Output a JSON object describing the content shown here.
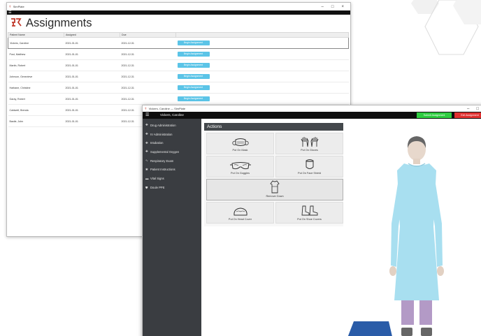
{
  "back_window": {
    "title": "SimPlate",
    "window_controls": [
      "–",
      "□",
      "×"
    ],
    "heading": "Assignments",
    "columns": [
      "Patient Name",
      "Assigned",
      "Due",
      ""
    ],
    "rows": [
      {
        "name": "Vickers, Caroline",
        "assigned": "2021-01-01",
        "due": "2021-12-31",
        "action": "Begin Assignment"
      },
      {
        "name": "Post, Matthew",
        "assigned": "2021-01-01",
        "due": "2021-12-31",
        "action": "Begin Assignment"
      },
      {
        "name": "Martin, Robert",
        "assigned": "2021-01-01",
        "due": "2021-12-31",
        "action": "Begin Assignment"
      },
      {
        "name": "Johnson, Genevieve",
        "assigned": "2021-01-01",
        "due": "2021-12-31",
        "action": "Begin Assignment"
      },
      {
        "name": "Harbane, Christine",
        "assigned": "2021-01-01",
        "due": "2021-12-31",
        "action": "Begin Assignment"
      },
      {
        "name": "Garay, Robert",
        "assigned": "2021-01-01",
        "due": "2021-12-31",
        "action": "Begin Assignment"
      },
      {
        "name": "Caldwell, Brenda",
        "assigned": "2021-01-01",
        "due": "2021-12-31",
        "action": ""
      },
      {
        "name": "Bastle, John",
        "assigned": "2021-01-01",
        "due": "2021-12-31",
        "action": ""
      }
    ]
  },
  "front_window": {
    "title": "Vickers, Caroline — SimPlate",
    "window_controls": [
      "–",
      "□"
    ],
    "patient_name": "Vickers, Caroline",
    "submit_label": "Submit Assignment",
    "exit_label": "Exit Assignment",
    "sidebar": [
      {
        "icon": "pill-icon",
        "glyph": "✚",
        "label": "Drug Administration"
      },
      {
        "icon": "iv-icon",
        "glyph": "✚",
        "label": "IV Administration"
      },
      {
        "icon": "intubate-icon",
        "glyph": "✚",
        "label": "Intubation"
      },
      {
        "icon": "oxygen-icon",
        "glyph": "✚",
        "label": "Supplemental Oxygen"
      },
      {
        "icon": "lungs-icon",
        "glyph": "∿",
        "label": "Respiratory Exam"
      },
      {
        "icon": "instructions-icon",
        "glyph": "✱",
        "label": "Patient Instructions"
      },
      {
        "icon": "monitor-icon",
        "glyph": "▬",
        "label": "Vital Signs"
      },
      {
        "icon": "shield-icon",
        "glyph": "⛊",
        "label": "Doule PPE"
      }
    ],
    "actions_heading": "Actions",
    "actions": [
      {
        "label": "Put On Mask",
        "icon": "mask-icon"
      },
      {
        "label": "Put On Gloves",
        "icon": "gloves-icon"
      },
      {
        "label": "Put On Goggles",
        "icon": "goggles-icon"
      },
      {
        "label": "Put On Face Shield",
        "icon": "face-shield-icon"
      },
      {
        "label": "Remove Gown",
        "icon": "gown-icon"
      },
      {
        "label": "Put On Head Cover",
        "icon": "head-cover-icon"
      },
      {
        "label": "Put On Shoe Covers",
        "icon": "shoe-covers-icon"
      }
    ],
    "colors": {
      "gown": "#a8dff0",
      "pants": "#b39ac6",
      "submit": "#2ecc40",
      "exit": "#e03030",
      "begin": "#5bc4e7"
    }
  }
}
